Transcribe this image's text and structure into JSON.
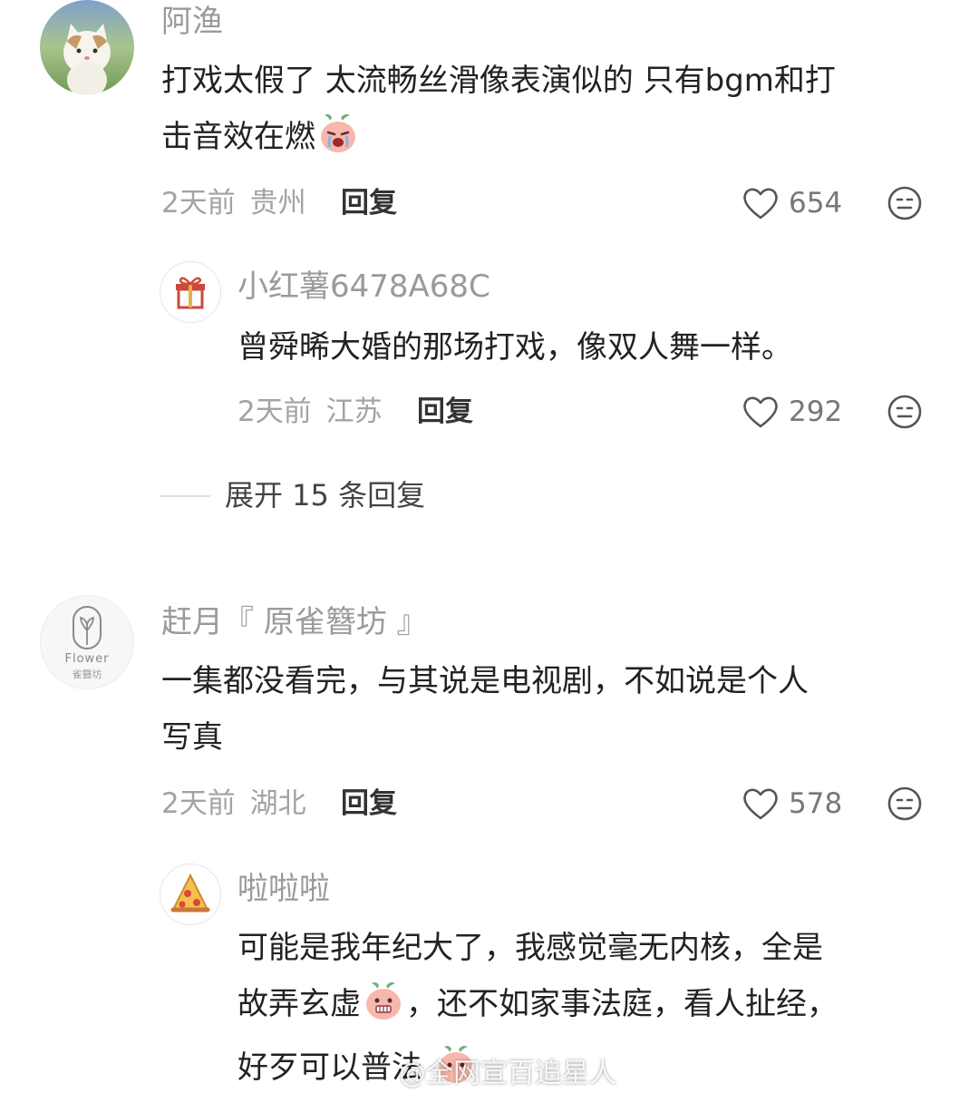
{
  "comments": [
    {
      "username": "阿渔",
      "text_line1": "打戏太假了 太流畅丝滑像表演似的 只有bgm和打",
      "text_line2": "击音效在燃",
      "time": "2天前",
      "location": "贵州",
      "reply_label": "回复",
      "likes": "654",
      "avatar_icon": "cat-avatar-icon",
      "replies": [
        {
          "username": "小红薯6478A68C",
          "text": "曾舜晞大婚的那场打戏，像双人舞一样。",
          "time": "2天前",
          "location": "江苏",
          "reply_label": "回复",
          "likes": "292",
          "avatar_icon": "gift-icon"
        }
      ],
      "expand_label": "展开 15 条回复"
    },
    {
      "username": "赶月『 原雀簪坊 』",
      "text_line1": "一集都没看完，与其说是电视剧，不如说是个人",
      "text_line2": "写真",
      "time": "2天前",
      "location": "湖北",
      "reply_label": "回复",
      "likes": "578",
      "avatar_icon": "flower-logo-icon",
      "avatar_text_top": "Flower",
      "avatar_text_bottom": "雀簪坊",
      "replies": [
        {
          "username": "啦啦啦",
          "text_line1": "可能是我年纪大了，我感觉毫无内核，全是",
          "text_line2_a": "故弄玄虚",
          "text_line2_b": "，还不如家事法庭，看人扯经，",
          "text_line3": "好歹可以普法",
          "avatar_icon": "pizza-icon"
        }
      ]
    }
  ],
  "watermark": "@全网宣百追星人",
  "colors": {
    "meta": "#a3a3a3",
    "text": "#222222",
    "username": "#9a9a9a"
  }
}
